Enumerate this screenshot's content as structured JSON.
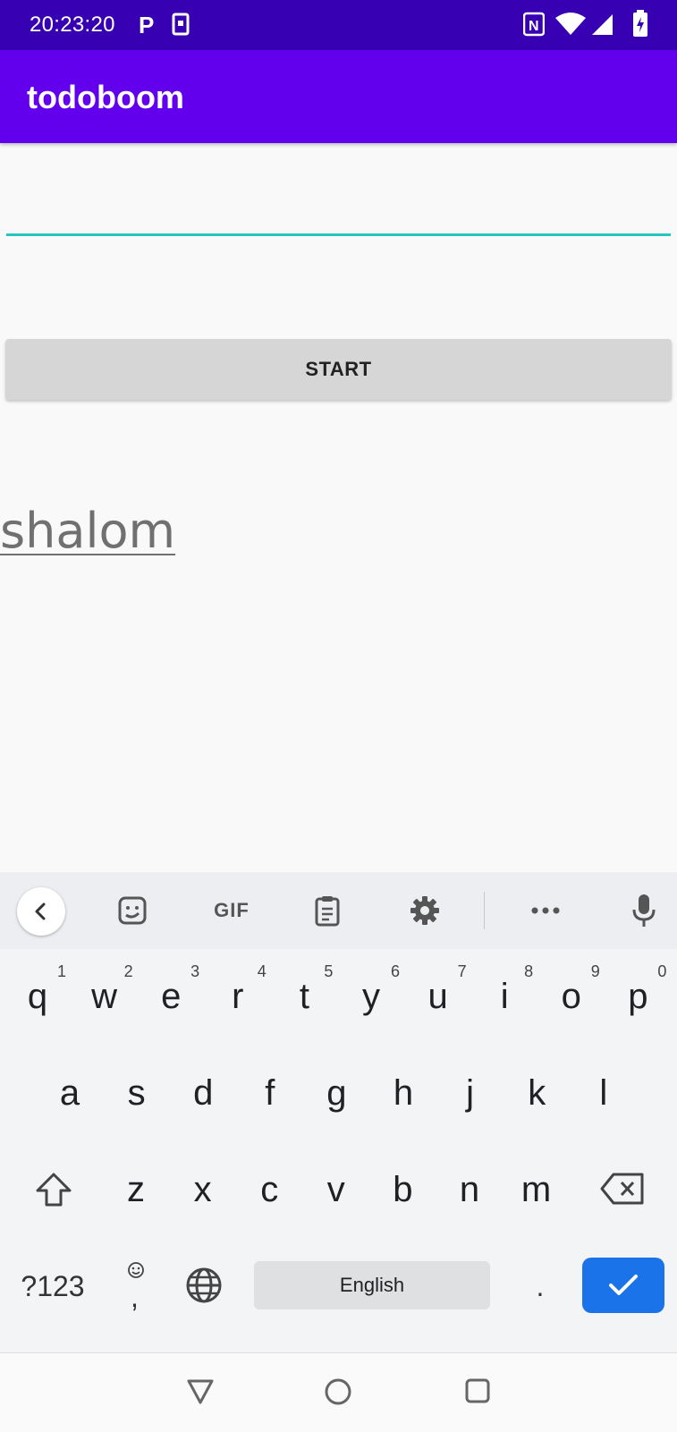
{
  "status_bar": {
    "time": "20:23:20"
  },
  "app_bar": {
    "title": "todoboom"
  },
  "main": {
    "text_field": {
      "value": "",
      "placeholder": ""
    },
    "start_button_label": "START",
    "list_item_text": "shalom"
  },
  "keyboard": {
    "toolbar_icons": [
      "back-icon",
      "sticker-icon",
      "gif-icon",
      "clipboard-icon",
      "settings-icon",
      "more-icon",
      "mic-icon"
    ],
    "gif_label": "GIF",
    "row1": [
      "q",
      "w",
      "e",
      "r",
      "t",
      "y",
      "u",
      "i",
      "o",
      "p"
    ],
    "row1_hints": [
      "1",
      "2",
      "3",
      "4",
      "5",
      "6",
      "7",
      "8",
      "9",
      "0"
    ],
    "row2": [
      "a",
      "s",
      "d",
      "f",
      "g",
      "h",
      "j",
      "k",
      "l"
    ],
    "row3": [
      "z",
      "x",
      "c",
      "v",
      "b",
      "n",
      "m"
    ],
    "symbols_label": "?123",
    "comma_label": ",",
    "space_label": "English",
    "period_label": ".",
    "accent_color": "#1a73e8"
  },
  "colors": {
    "status_bar": "#3700b3",
    "app_bar": "#6200ee",
    "field_underline": "#26c6c0",
    "button_bg": "#d6d6d6"
  }
}
